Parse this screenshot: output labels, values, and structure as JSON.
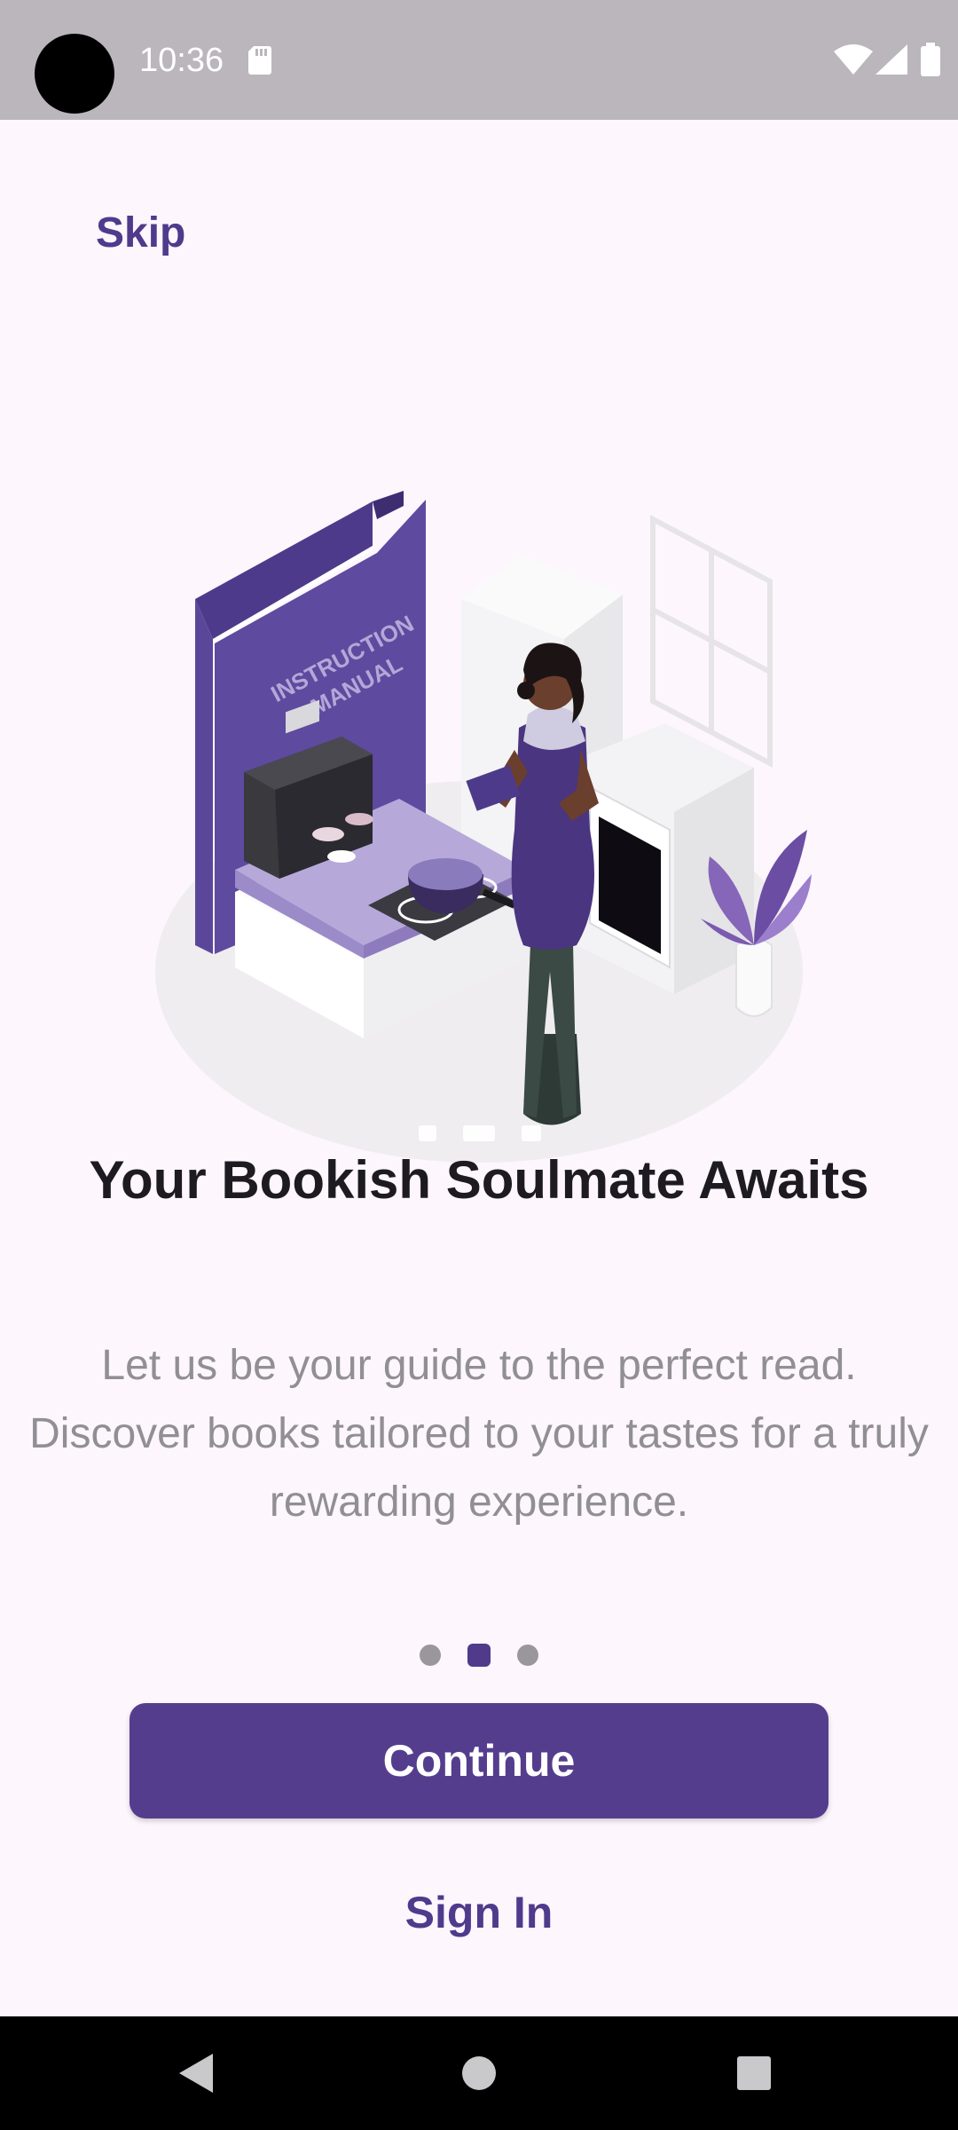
{
  "status_bar": {
    "time": "10:36",
    "icons": [
      "sd-card-icon",
      "wifi-icon",
      "signal-icon",
      "battery-icon"
    ]
  },
  "onboarding": {
    "skip_label": "Skip",
    "illustration_text": "INSTRUCTION MANUAL",
    "title": "Your Bookish Soulmate Awaits",
    "subtitle": "Let us be your guide to the perfect read. Discover books tailored to your tastes for a truly rewarding experience.",
    "page_indicator": {
      "total": 3,
      "active_index": 1
    },
    "continue_label": "Continue",
    "signin_label": "Sign In"
  },
  "nav_bar": {
    "buttons": [
      "back-icon",
      "home-icon",
      "recents-icon"
    ]
  },
  "colors": {
    "primary": "#553d8e",
    "accent_text": "#4f3a8c",
    "background": "#fdf6fd",
    "status_bar": "#bab6bc",
    "title_text": "#1d1a22",
    "subtitle_text": "#928e96",
    "inactive_dot": "#9a969c"
  }
}
